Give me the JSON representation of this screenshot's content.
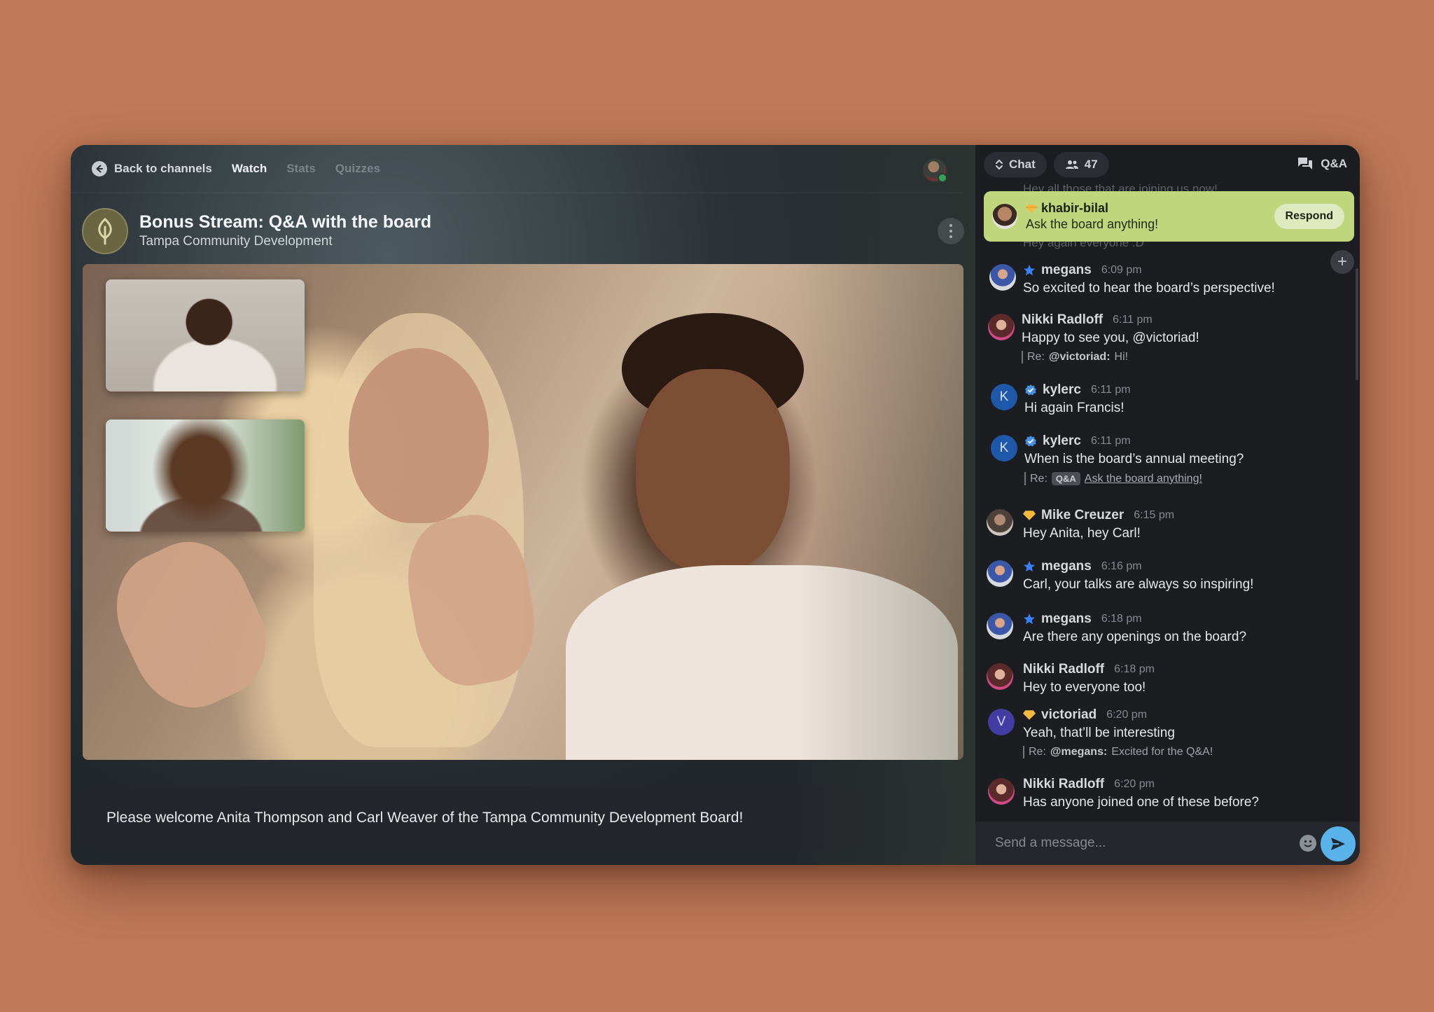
{
  "nav": {
    "back_label": "Back to channels",
    "tabs": [
      {
        "label": "Watch",
        "active": true
      },
      {
        "label": "Stats",
        "active": false
      },
      {
        "label": "Quizzes",
        "active": false
      }
    ]
  },
  "stream": {
    "title": "Bonus Stream: Q&A with the board",
    "channel": "Tampa Community Development",
    "caption": "Please welcome Anita Thompson and Carl Weaver of the Tampa Community Development Board!"
  },
  "chat": {
    "mode_label": "Chat",
    "viewer_count": "47",
    "qa_label": "Q&A",
    "ghost_top": "Hey all those that are joining us now!",
    "ghost_pinned_under": "Hey again everyone :D",
    "pinned": {
      "user": "khabir-bilal",
      "message": "Ask the board anything!",
      "respond_label": "Respond"
    },
    "messages": [
      {
        "user": "megans",
        "time": "6:09 pm",
        "text": "So excited to hear the board’s perspective!",
        "badge": "star",
        "avatar": "photo"
      },
      {
        "user": "Nikki Radloff",
        "time": "6:11 pm",
        "text": "Happy to see you, @victoriad!",
        "reply_prefix": "Re:",
        "reply_user": "@victoriad:",
        "reply_text": "Hi!",
        "avatar": "photo"
      },
      {
        "user": "kylerc",
        "time": "6:11 pm",
        "text": "Hi again Francis!",
        "badge": "verified",
        "avatar_letter": "K"
      },
      {
        "user": "kylerc",
        "time": "6:11 pm",
        "text": "When is the board’s annual meeting?",
        "badge": "verified",
        "avatar_letter": "K",
        "reply_prefix": "Re:",
        "reply_tag": "Q&A",
        "reply_link": "Ask the board anything!"
      },
      {
        "user": "Mike Creuzer",
        "time": "6:15 pm",
        "text": "Hey Anita, hey Carl!",
        "badge": "diamond",
        "avatar": "photo"
      },
      {
        "user": "megans",
        "time": "6:16 pm",
        "text": "Carl, your talks are always so inspiring!",
        "badge": "star",
        "avatar": "photo"
      },
      {
        "user": "megans",
        "time": "6:18 pm",
        "text": "Are there any openings on the board?",
        "badge": "star",
        "avatar": "photo"
      },
      {
        "user": "Nikki Radloff",
        "time": "6:18 pm",
        "text": "Hey to everyone too!",
        "avatar": "photo"
      },
      {
        "user": "victoriad",
        "time": "6:20 pm",
        "text": "Yeah, that’ll be interesting",
        "badge": "diamond",
        "avatar_letter": "V",
        "reply_prefix": "Re:",
        "reply_user": "@megans:",
        "reply_text": "Excited for the Q&A!"
      },
      {
        "user": "Nikki Radloff",
        "time": "6:20 pm",
        "text": "Has anyone joined one of these before?",
        "avatar": "photo"
      }
    ],
    "composer_placeholder": "Send a message..."
  },
  "colors": {
    "background": "#bf7a58",
    "pinned_bg": "#bfd67c",
    "send_button": "#5ab2ea",
    "star_badge": "#3b82f6",
    "diamond_badge": "#f5b942"
  }
}
